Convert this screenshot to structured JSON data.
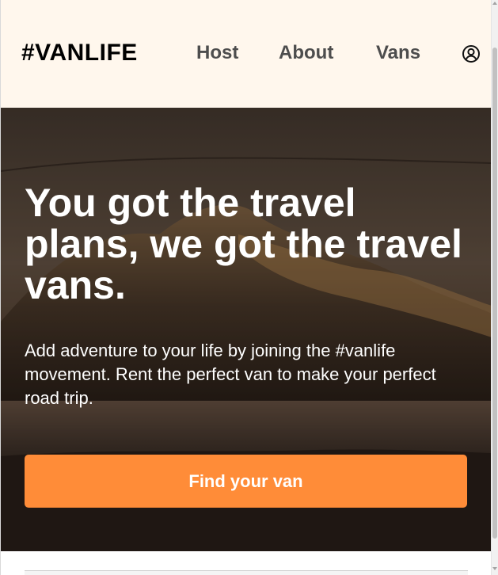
{
  "header": {
    "logo": "#VANLIFE",
    "nav": {
      "host": "Host",
      "about": "About",
      "vans": "Vans"
    },
    "user_icon": "user-circle-icon"
  },
  "hero": {
    "background_icon": "mountain-lake-photo",
    "title": "You got the travel plans, we got the travel vans.",
    "subtitle": "Add adventure to your life by joining the #vanlife movement. Rent the perfect van to make your perfect road trip.",
    "cta_label": "Find your van"
  },
  "colors": {
    "header_bg": "#FFF7ED",
    "cta_bg": "#FF8C38",
    "nav_text": "#4D4D4D",
    "hero_text": "#FFFFFF"
  }
}
